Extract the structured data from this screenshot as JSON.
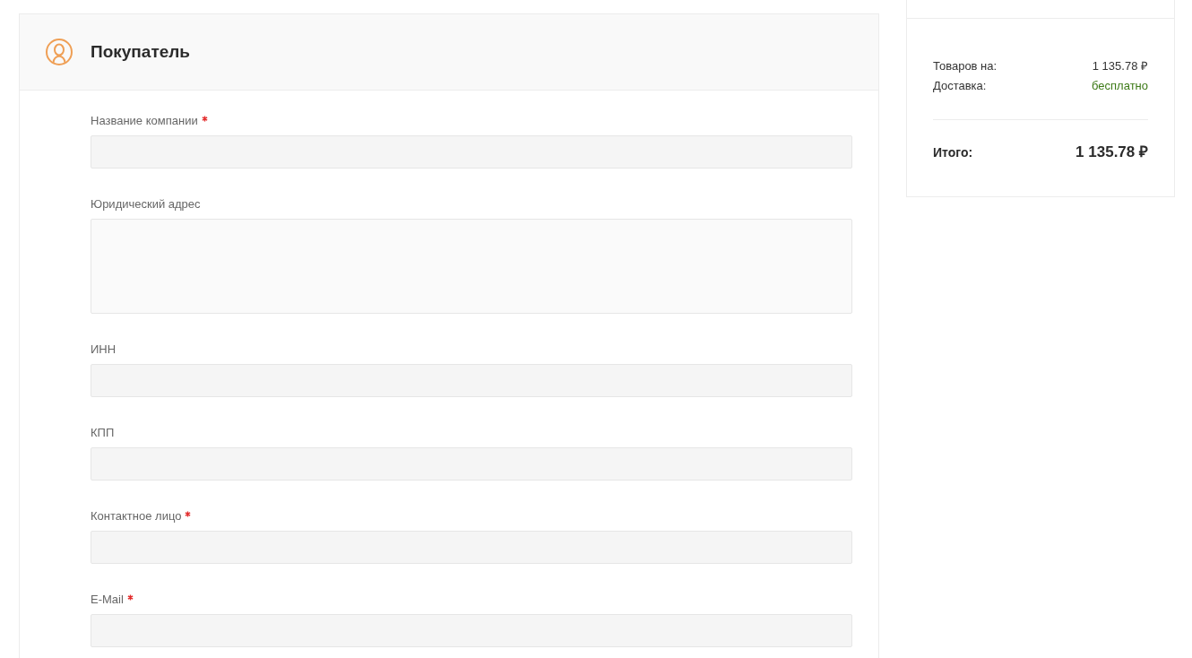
{
  "buyer_section": {
    "title": "Покупатель",
    "fields": [
      {
        "label": "Название компании",
        "required": true,
        "kind": "input"
      },
      {
        "label": "Юридический адрес",
        "required": false,
        "kind": "textarea"
      },
      {
        "label": "ИНН",
        "required": false,
        "kind": "input"
      },
      {
        "label": "КПП",
        "required": false,
        "kind": "input"
      },
      {
        "label": "Контактное лицо",
        "required": true,
        "kind": "input"
      },
      {
        "label": "E-Mail",
        "required": true,
        "kind": "input"
      }
    ]
  },
  "summary": {
    "rows": [
      {
        "label": "Товаров на:",
        "value": "1 135.78 ₽",
        "kind": "amount"
      },
      {
        "label": "Доставка:",
        "value": "бесплатно",
        "kind": "free"
      }
    ],
    "total": {
      "label": "Итого:",
      "value": "1 135.78 ₽"
    }
  }
}
